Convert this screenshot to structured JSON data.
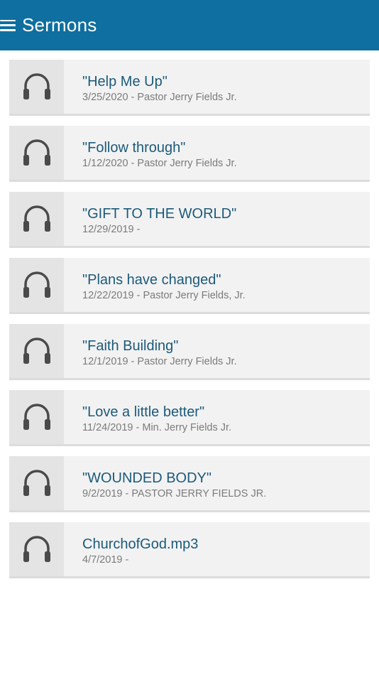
{
  "header": {
    "menu_icon": "hamburger-menu-icon",
    "title": "Sermons",
    "background": "#0e6fa0"
  },
  "sermons": [
    {
      "icon": "headphones-icon",
      "title": "\"Help Me Up\"",
      "meta": "3/25/2020 - Pastor Jerry Fields Jr."
    },
    {
      "icon": "headphones-icon",
      "title": "\"Follow through\"",
      "meta": "1/12/2020 - Pastor Jerry Fields Jr."
    },
    {
      "icon": "headphones-icon",
      "title": "\"GIFT TO THE WORLD\"",
      "meta": "12/29/2019 -"
    },
    {
      "icon": "headphones-icon",
      "title": "\"Plans have changed\"",
      "meta": "12/22/2019 - Pastor Jerry Fields, Jr."
    },
    {
      "icon": "headphones-icon",
      "title": "\"Faith Building\"",
      "meta": "12/1/2019 - Pastor Jerry Fields Jr."
    },
    {
      "icon": "headphones-icon",
      "title": "\"Love a little better\"",
      "meta": "11/24/2019 - Min. Jerry Fields Jr."
    },
    {
      "icon": "headphones-icon",
      "title": "\"WOUNDED BODY\"",
      "meta": "9/2/2019 - PASTOR JERRY FIELDS JR."
    },
    {
      "icon": "headphones-icon",
      "title": "ChurchofGod.mp3",
      "meta": "4/7/2019 -"
    }
  ]
}
